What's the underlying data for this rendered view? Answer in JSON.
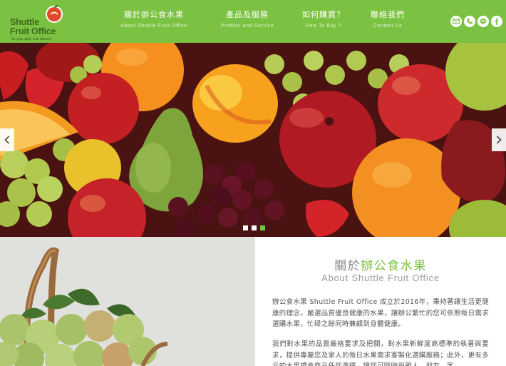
{
  "brand": {
    "line1": "Shuttle",
    "line2": "Fruit Office",
    "tagline": "for your daily fruit delivery",
    "icon": "apple-logo-icon",
    "color": "#7cc242"
  },
  "nav": {
    "items": [
      {
        "zh": "關於辦公食水果",
        "en": "About Shuttle Fruit Office"
      },
      {
        "zh": "產品及服務",
        "en": "Product and Service"
      },
      {
        "zh": "如何購買？",
        "en": "How To Buy ?"
      },
      {
        "zh": "聯絡我們",
        "en": "Contact Us"
      }
    ]
  },
  "social": {
    "icons": [
      "mail-icon",
      "phone-icon",
      "line-icon",
      "facebook-icon"
    ]
  },
  "hero": {
    "prev_icon": "chevron-left-icon",
    "next_icon": "chevron-right-icon",
    "slide_count": 3,
    "active_slide": 3
  },
  "about": {
    "title_prefix": "關於",
    "title_highlight": "辦公食水果",
    "subtitle": "About Shuttle Fruit Office",
    "paragraph1": "辦公食水果 Shuttle Fruit Office 成立於2016年，秉持著讓生活更健康的理念，嚴選品質優良健康的水果，讓辦公繁忙的您可依照每日需求選購水果，忙碌之餘同時兼顧到身體健康。",
    "paragraph2": "我們對水果的品質嚴格要求及把關，對水果新鮮度高標準的執著與要求，提供專屬您及家人的每日水果需求客製化選購服務；此外，更有多元的水果禮盒商品任您選擇，讓您可隨時與親人、朋友、客"
  }
}
